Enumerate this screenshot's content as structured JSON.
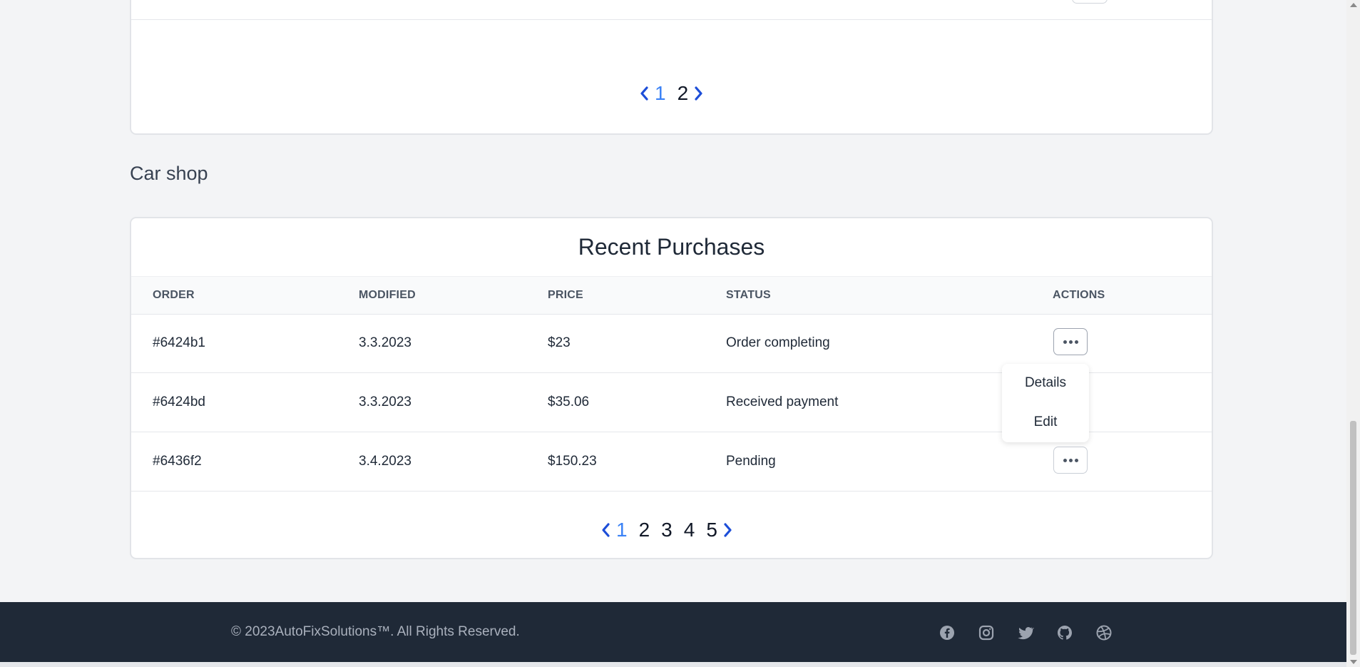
{
  "top_pagination": {
    "pages": [
      "1",
      "2"
    ],
    "active": "1"
  },
  "section_title": "Car shop",
  "purchases": {
    "title": "Recent Purchases",
    "columns": {
      "order": "ORDER",
      "modified": "MODIFIED",
      "price": "PRICE",
      "status": "STATUS",
      "actions": "ACTIONS"
    },
    "rows": [
      {
        "order": "#6424b1",
        "modified": "3.3.2023",
        "price": "$23",
        "status": "Order completing"
      },
      {
        "order": "#6424bd",
        "modified": "3.3.2023",
        "price": "$35.06",
        "status": "Received payment"
      },
      {
        "order": "#6436f2",
        "modified": "3.4.2023",
        "price": "$150.23",
        "status": "Pending"
      }
    ],
    "dropdown": {
      "details": "Details",
      "edit": "Edit"
    },
    "pagination": {
      "pages": [
        "1",
        "2",
        "3",
        "4",
        "5"
      ],
      "active": "1"
    }
  },
  "footer": {
    "copyright": "© 2023AutoFixSolutions™. All Rights Reserved.",
    "social_icons": [
      "facebook-icon",
      "instagram-icon",
      "twitter-icon",
      "github-icon",
      "dribbble-icon"
    ]
  },
  "colors": {
    "accent": "#1d4ed8",
    "active_page": "#3b82f6",
    "footer_bg": "#1f2937",
    "page_bg": "#f3f4f6"
  }
}
